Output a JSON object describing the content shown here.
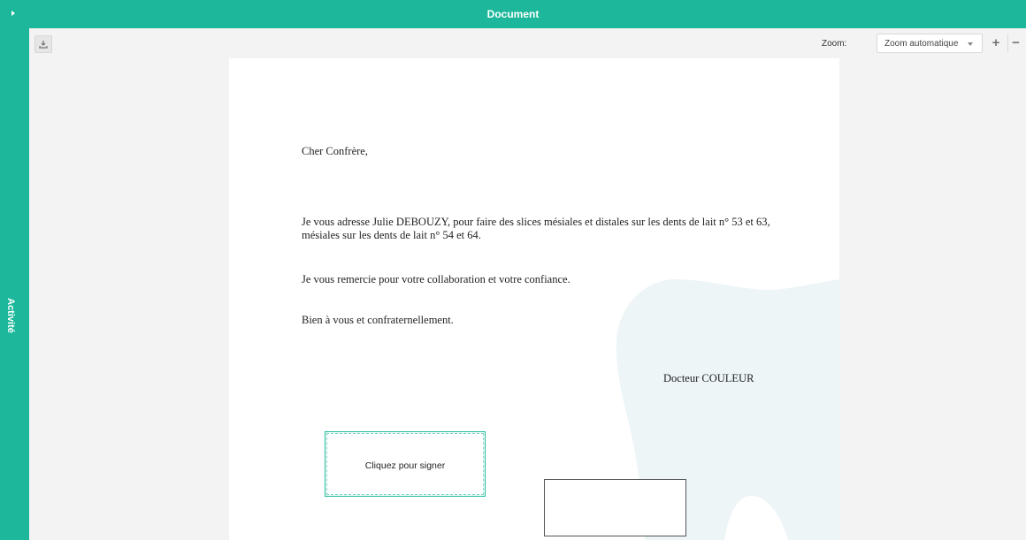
{
  "header": {
    "title": "Document"
  },
  "sidebar": {
    "label": "Activité"
  },
  "toolbar": {
    "zoom_label": "Zoom:",
    "zoom_value": "Zoom automatique",
    "zoom_in": "+",
    "zoom_out": "−"
  },
  "letter": {
    "salutation": "Cher Confrère,",
    "paragraph1": "Je vous adresse Julie DEBOUZY, pour faire des slices mésiales et distales sur les dents de lait n° 53 et 63, mésiales sur les dents de lait n° 54 et 64.",
    "paragraph2": "Je vous remercie pour votre collaboration et votre confiance.",
    "closing": "Bien à vous et confraternellement.",
    "signatory": "Docteur COULEUR"
  },
  "signature": {
    "prompt": "Cliquez pour signer"
  },
  "colors": {
    "accent": "#1db89b",
    "watermark": "#edf5f7"
  }
}
